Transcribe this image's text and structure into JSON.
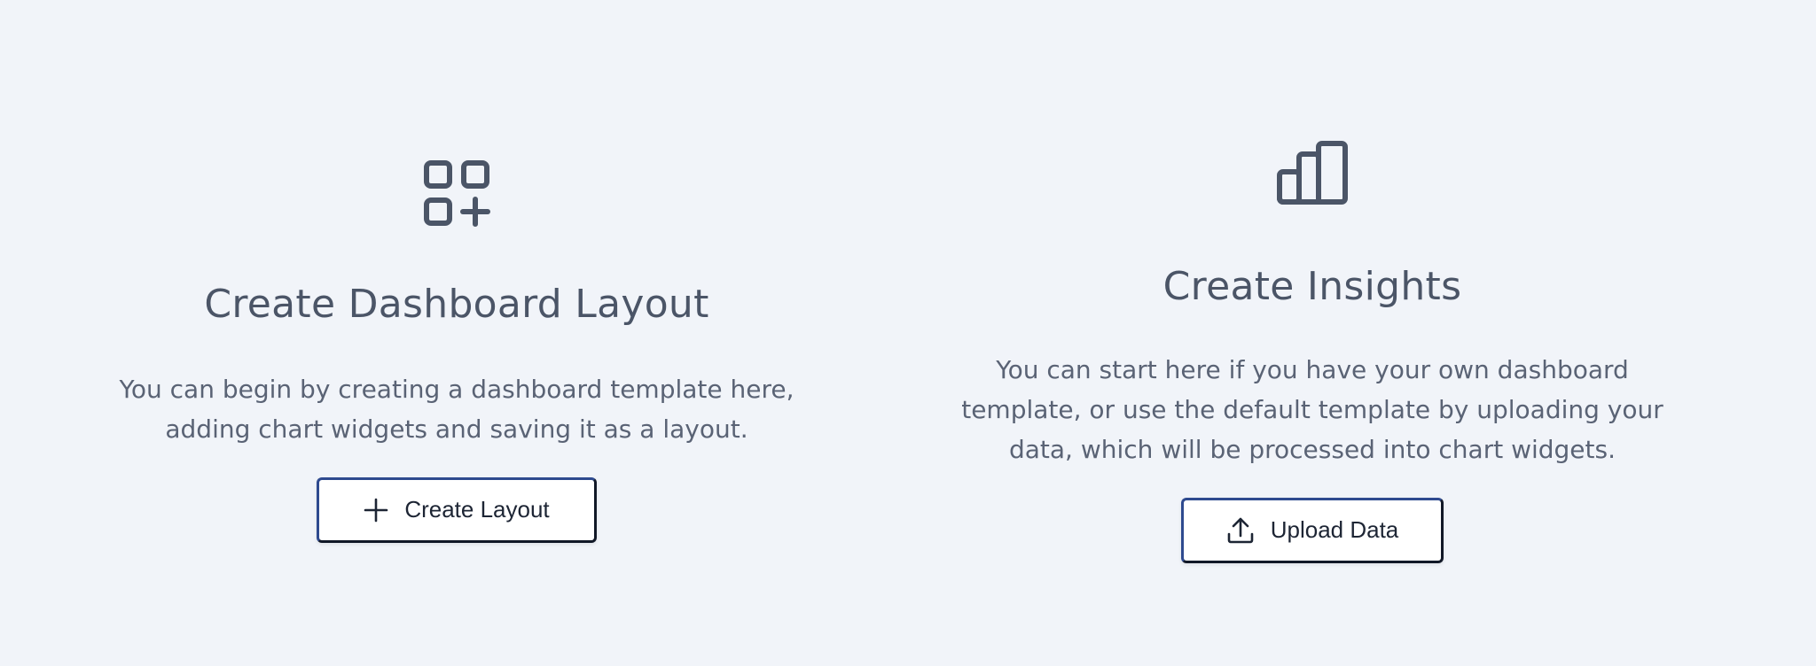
{
  "layout_card": {
    "icon": "grid-plus-icon",
    "title": "Create Dashboard Layout",
    "description": "You can begin by creating a dashboard template here, adding chart widgets and saving it as a layout.",
    "button": {
      "icon": "plus-icon",
      "label": "Create Layout"
    }
  },
  "insights_card": {
    "icon": "bar-chart-icon",
    "title": "Create Insights",
    "description": "You can start here if you have your own dashboard template, or use the default template by uploading your data, which will be processed into chart widgets.",
    "button": {
      "icon": "upload-icon",
      "label": "Upload Data"
    }
  },
  "colors": {
    "background": "#f1f4f9",
    "icon": "#4b5567",
    "text": "#4b5567",
    "button_border": "#2e4a8f",
    "button_text": "#1d2534"
  }
}
